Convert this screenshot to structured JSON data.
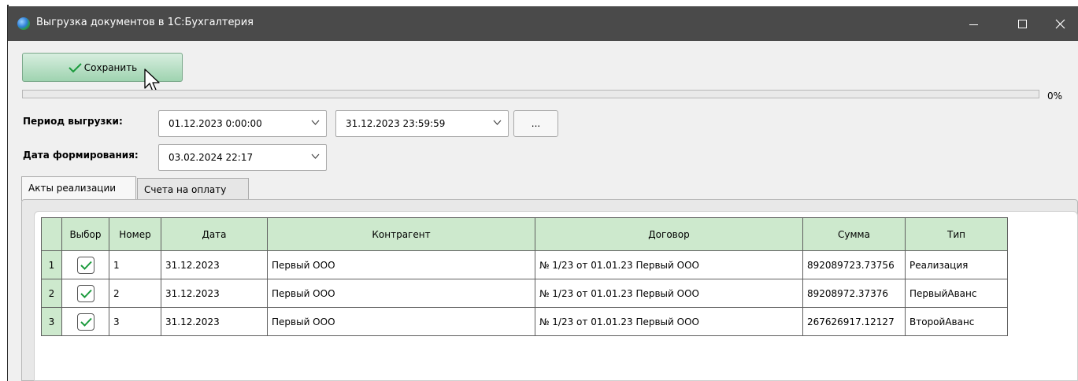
{
  "window": {
    "title": "Выгрузка документов в 1С:Бухгалтерия",
    "controls": [
      "minimize-icon",
      "maximize-icon",
      "close-icon"
    ]
  },
  "toolbar": {
    "save_label": "Сохранить"
  },
  "progress": {
    "value_percent": 0,
    "label": "0%"
  },
  "period": {
    "label": "Период выгрузки:",
    "from": "01.12.2023 0:00:00",
    "to": "31.12.2023 23:59:59",
    "more_button": "..."
  },
  "formation": {
    "label": "Дата формирования:",
    "value": "03.02.2024 22:17"
  },
  "tabs": [
    {
      "label": "Акты реализации",
      "active": true
    },
    {
      "label": "Счета на оплату",
      "active": false
    }
  ],
  "table": {
    "columns": [
      "",
      "Выбор",
      "Номер",
      "Дата",
      "Контрагент",
      "Договор",
      "Сумма",
      "Тип"
    ],
    "rows": [
      {
        "n": "1",
        "selected": true,
        "number": "1",
        "date": "31.12.2023",
        "counterparty": "Первый ООО",
        "contract": "№ 1/23 от 01.01.23 Первый ООО",
        "sum": "892089723.73756",
        "type": "Реализация"
      },
      {
        "n": "2",
        "selected": true,
        "number": "2",
        "date": "31.12.2023",
        "counterparty": "Первый ООО",
        "contract": "№ 1/23 от 01.01.23 Первый ООО",
        "sum": "89208972.37376",
        "type": "ПервыйАванс"
      },
      {
        "n": "3",
        "selected": true,
        "number": "3",
        "date": "31.12.2023",
        "counterparty": "Первый ООО",
        "contract": "№ 1/23 от 01.01.23 Первый ООО",
        "sum": "267626917.12127",
        "type": "ВторойАванс"
      }
    ]
  },
  "colors": {
    "titlebar": "#4a4a4a",
    "header_green": "#cde9cd",
    "save_button": "#9fd3b0",
    "check_green": "#1a9a3c"
  }
}
